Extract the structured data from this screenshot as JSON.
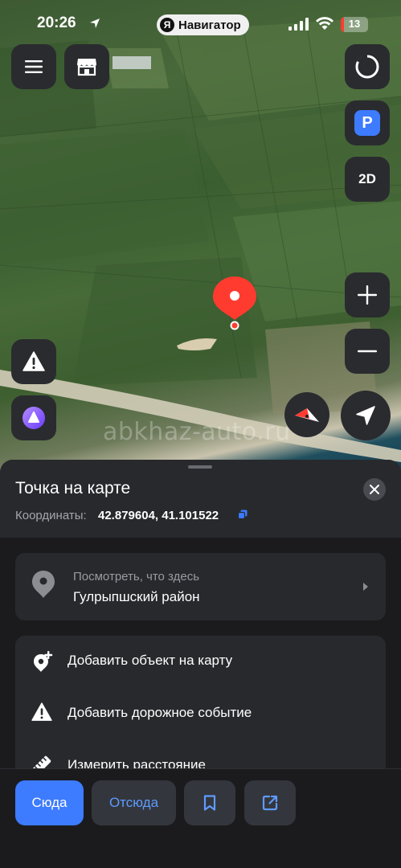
{
  "status_bar": {
    "time": "20:26",
    "app_name": "Навигатор",
    "app_logo": "Я",
    "battery": "13"
  },
  "map": {
    "watermark": "abkhaz-auto.ru",
    "mode_label": "2D",
    "parking_label": "P"
  },
  "place": {
    "title": "Точка на карте",
    "coords_label": "Координаты:",
    "coords_value": "42.879604, 41.101522"
  },
  "whats_here": {
    "subtitle": "Посмотреть, что здесь",
    "name": "Гулрыпшский район"
  },
  "actions": [
    {
      "label": "Добавить объект на карту",
      "icon": "add-place-icon"
    },
    {
      "label": "Добавить дорожное событие",
      "icon": "warning-icon"
    },
    {
      "label": "Измерить расстояние",
      "icon": "ruler-icon"
    }
  ],
  "bottom_bar": {
    "to_here": "Сюда",
    "from_here": "Отсюда"
  },
  "colors": {
    "accent": "#3d7bff",
    "pin": "#ff3b30",
    "sheet": "#1b1b1e",
    "card": "#28292d"
  }
}
